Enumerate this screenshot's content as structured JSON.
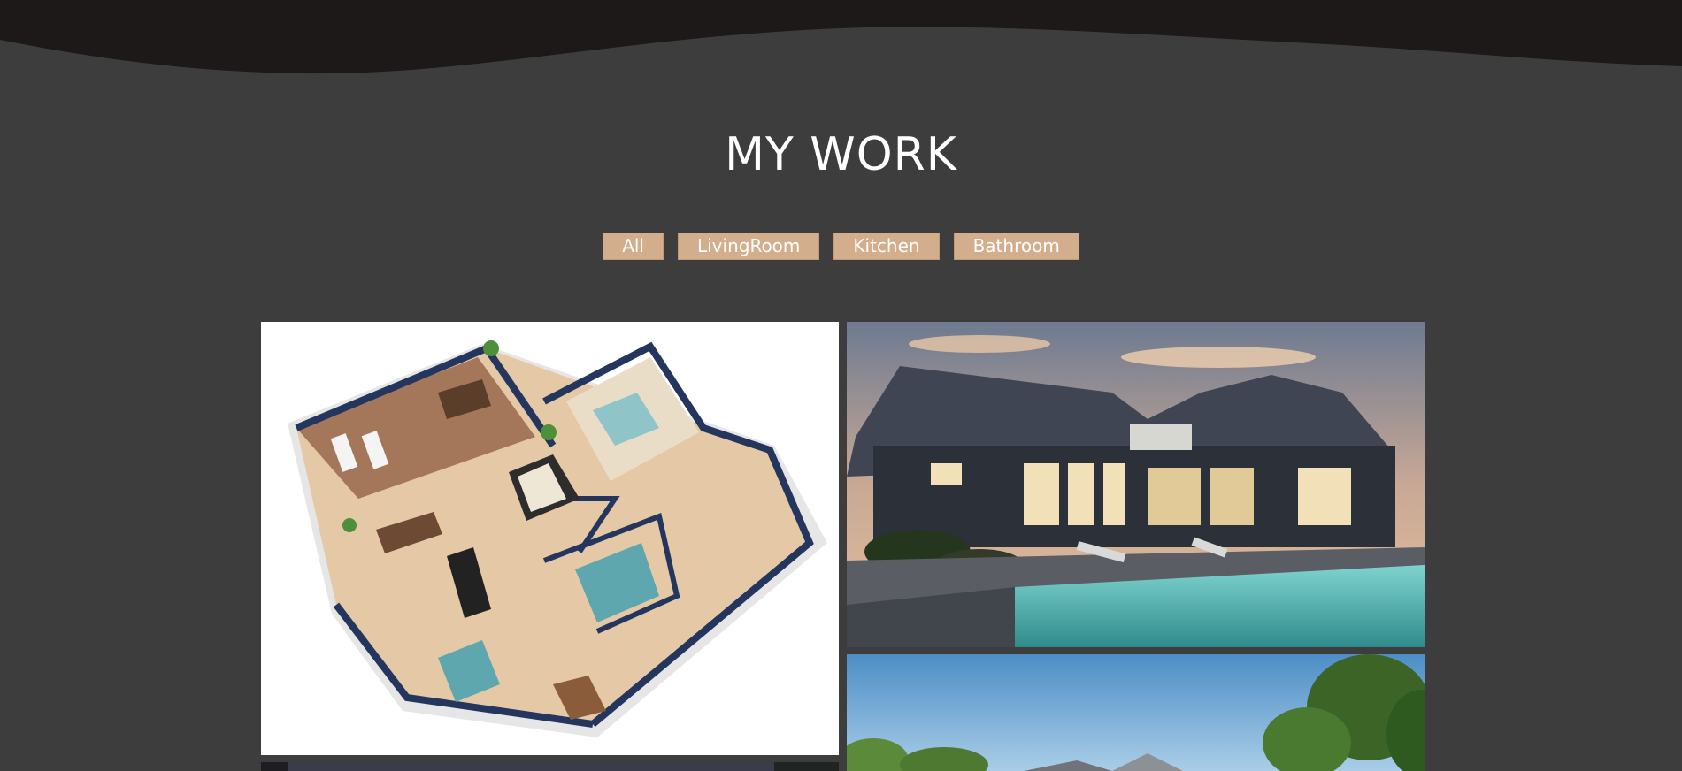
{
  "section": {
    "title": "MY WORK"
  },
  "filters": [
    {
      "label": "All"
    },
    {
      "label": "LivingRoom"
    },
    {
      "label": "Kitchen"
    },
    {
      "label": "Bathroom"
    }
  ],
  "gallery": [
    {
      "name": "floor-plan-3d-image"
    },
    {
      "name": "house-pool-dusk-image"
    },
    {
      "name": "house-exterior-day-image"
    },
    {
      "name": "house-night-image"
    }
  ],
  "colors": {
    "background": "#3d3d3d",
    "wave": "#1c1918",
    "accent": "#d2ae8c",
    "text": "#ffffff"
  }
}
